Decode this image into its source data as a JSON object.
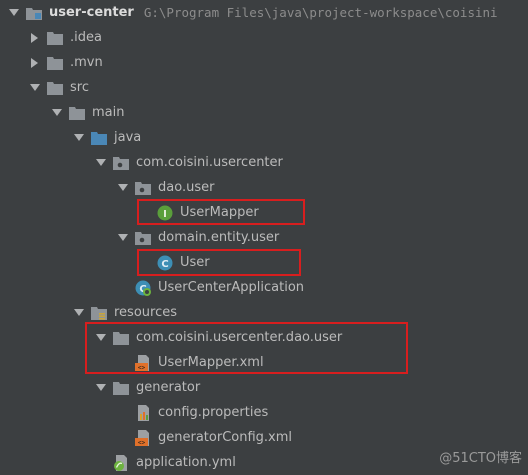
{
  "tree": {
    "root": {
      "label": "user-center",
      "path": "G:\\Program Files\\java\\project-workspace\\coisini"
    },
    "items": [
      {
        "label": ".idea"
      },
      {
        "label": ".mvn"
      },
      {
        "label": "src"
      },
      {
        "label": "main"
      },
      {
        "label": "java"
      },
      {
        "label": "com.coisini.usercenter"
      },
      {
        "label": "dao.user"
      },
      {
        "label": "UserMapper"
      },
      {
        "label": "domain.entity.user"
      },
      {
        "label": "User"
      },
      {
        "label": "UserCenterApplication"
      },
      {
        "label": "resources"
      },
      {
        "label": "com.coisini.usercenter.dao.user"
      },
      {
        "label": "UserMapper.xml"
      },
      {
        "label": "generator"
      },
      {
        "label": "config.properties"
      },
      {
        "label": "generatorConfig.xml"
      },
      {
        "label": "application.yml"
      }
    ]
  },
  "colors": {
    "background": "#3c3f41",
    "highlight": "#d81e1e",
    "folder": "#8e9398",
    "source_folder": "#4a87b6",
    "interface_icon": "#5a9f3b",
    "class_icon": "#3d8fb5"
  },
  "watermark": "@51CTO博客"
}
